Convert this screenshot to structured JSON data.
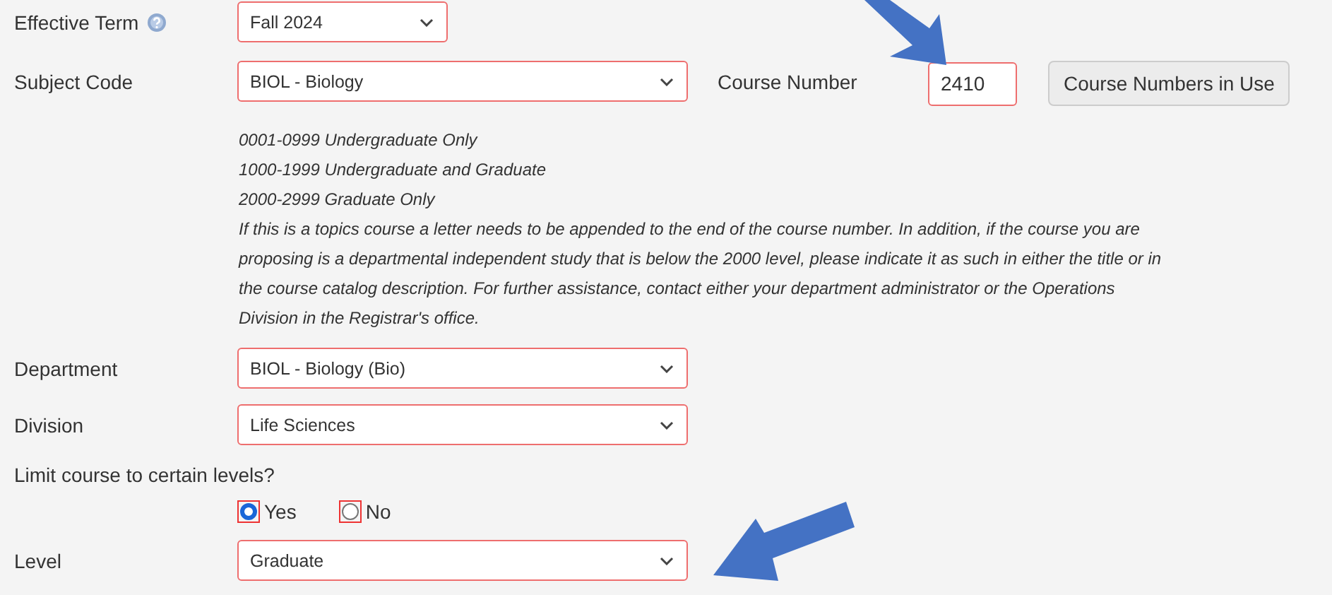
{
  "effective_term": {
    "label": "Effective Term",
    "value": "Fall 2024"
  },
  "subject_code": {
    "label": "Subject Code",
    "value": "BIOL - Biology"
  },
  "course_number": {
    "label": "Course Number",
    "value": "2410"
  },
  "course_numbers_button": "Course Numbers in Use",
  "number_ranges": [
    "0001-0999 Undergraduate Only",
    "1000-1999 Undergraduate and Graduate",
    "2000-2999 Graduate Only"
  ],
  "topics_note": "If this is a topics course a letter needs to be appended to the end of the course number. In addition, if the course you are proposing is a departmental independent study that is below the 2000 level, please indicate it as such in either the title or in the course catalog description. For further assistance, contact either your department administrator or the Operations Division in the Registrar's office.",
  "department": {
    "label": "Department",
    "value": "BIOL - Biology (Bio)"
  },
  "division": {
    "label": "Division",
    "value": "Life Sciences"
  },
  "limit_levels": {
    "label": "Limit course to certain levels?",
    "options": [
      {
        "label": "Yes",
        "selected": true
      },
      {
        "label": "No",
        "selected": false
      }
    ]
  },
  "level": {
    "label": "Level",
    "value": "Graduate"
  }
}
